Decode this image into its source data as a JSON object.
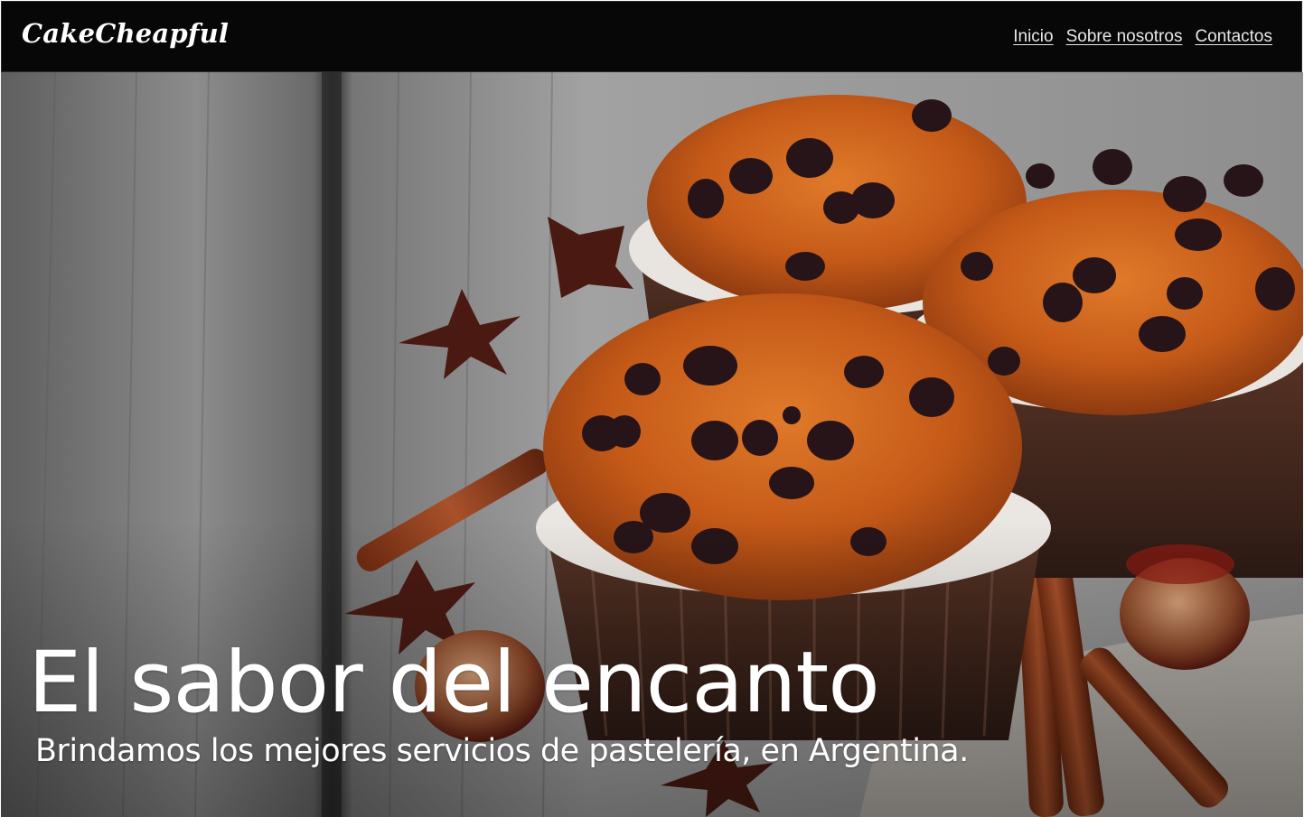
{
  "header": {
    "logo": "CakeCheapful",
    "nav": [
      {
        "label": "Inicio"
      },
      {
        "label": "Sobre nosotros"
      },
      {
        "label": "Contactos"
      }
    ]
  },
  "hero": {
    "title": "El sabor del encanto",
    "subtitle": "Brindamos los mejores servicios de pastelería, en Argentina.",
    "image_icon": "chocolate-chip-muffins-photo"
  },
  "colors": {
    "navbar_bg": "#070708",
    "nav_text": "#e8e8e8",
    "hero_text": "#ffffff",
    "muffin": "#c8641e",
    "chocolate": "#2a1a1e",
    "cinnamon": "#8a3a1a",
    "wood": "#8a8a8a"
  }
}
